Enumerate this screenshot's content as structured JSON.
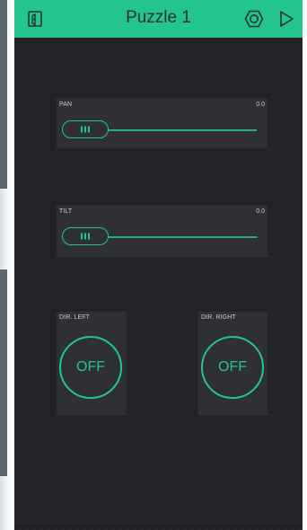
{
  "app": {
    "title": "Puzzle 1",
    "accent_color": "#23c48e",
    "background_color": "#212227",
    "icons": {
      "left": "exit-icon",
      "settings": "hexagon-settings-icon",
      "play": "play-icon"
    }
  },
  "sliders": [
    {
      "label": "PAN",
      "value": "0.0",
      "level": 0
    },
    {
      "label": "TILT",
      "value": "0.0",
      "level": 0
    }
  ],
  "buttons": [
    {
      "label": "DIR. LEFT",
      "state": "OFF"
    },
    {
      "label": "DIR. RIGHT",
      "state": "OFF"
    }
  ]
}
